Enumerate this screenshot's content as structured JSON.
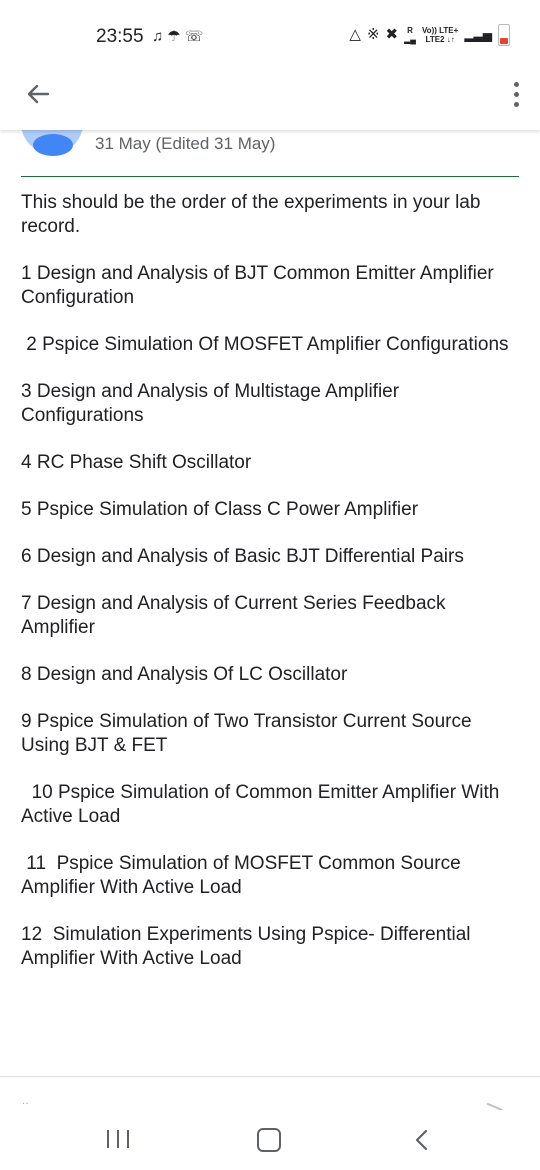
{
  "status_bar": {
    "time": "23:55",
    "left_icons": [
      "notification-icon",
      "snapchat-icon",
      "whatsapp-icon"
    ],
    "right_icons": [
      "data-saver-icon",
      "bluetooth-icon",
      "mute-icon",
      "signal-r-icon",
      "volte-icon",
      "signal-icon",
      "battery-icon"
    ],
    "network_line1": "Vo)) LTE+",
    "network_line2": "LTE2 ↓↑",
    "roaming": "R"
  },
  "app_bar": {
    "back_icon": "arrow-back-icon",
    "menu_icon": "more-vert-icon"
  },
  "post": {
    "date": "31 May (Edited 31 May)",
    "intro": "This should be the order of the experiments in your lab record.",
    "items": [
      "1 Design and Analysis of BJT Common Emitter Amplifier Configuration",
      " 2 Pspice Simulation Of MOSFET Amplifier Configurations",
      "3 Design and Analysis of Multistage Amplifier Configurations",
      "4 RC Phase Shift Oscillator",
      "5 Pspice Simulation of Class C Power Amplifier",
      "6 Design and Analysis of Basic BJT Differential Pairs",
      "7 Design and Analysis of Current Series Feedback Amplifier",
      "8 Design and Analysis Of LC Oscillator",
      "9 Pspice Simulation of Two Transistor Current Source Using BJT & FET",
      "  10 Pspice Simulation of Common Emitter Amplifier With Active Load",
      " 11  Pspice Simulation of MOSFET Common Source Amplifier With Active Load",
      "12  Simulation Experiments Using Pspice- Differential Amplifier With Active Load"
    ]
  },
  "colors": {
    "divider": "#1e6b3a",
    "avatar_outer": "#aecbfa",
    "avatar_inner": "#4285f4",
    "text": "#202124",
    "secondary_text": "#5f6368"
  },
  "nav_bar": {
    "recent_icon": "recent-apps-icon",
    "home_icon": "home-icon",
    "back_icon": "nav-back-icon"
  }
}
